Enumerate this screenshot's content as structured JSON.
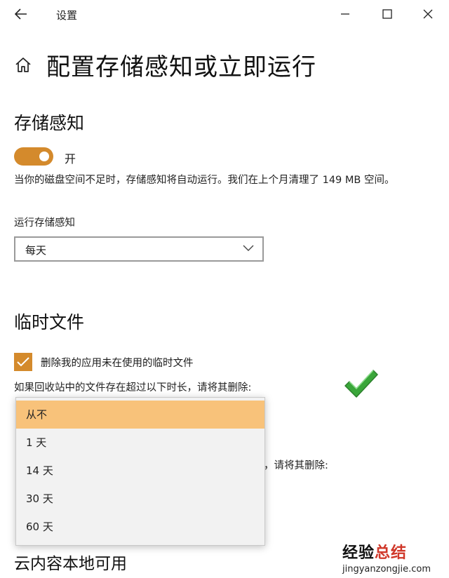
{
  "window": {
    "title": "设置",
    "back_icon": "back-arrow-icon",
    "minimize_icon": "minimize-icon",
    "maximize_icon": "maximize-icon",
    "close_icon": "close-icon"
  },
  "page": {
    "home_icon": "home-icon",
    "title": "配置存储感知或立即运行"
  },
  "storage_sense": {
    "heading": "存储感知",
    "toggle_state": "开",
    "toggle_on": true,
    "description": "当你的磁盘空间不足时，存储感知将自动运行。我们在上个月清理了 149 MB 空间。",
    "run_label": "运行存储感知",
    "run_value": "每天"
  },
  "temp_files": {
    "heading": "临时文件",
    "delete_checkbox_label": "删除我的应用未在使用的临时文件",
    "delete_checked": true,
    "recycle_label": "如果回收站中的文件存在超过以下时长，请将其删除:",
    "hidden_label_fragment": "，请将其删除:",
    "options": [
      "从不",
      "1 天",
      "14 天",
      "30 天",
      "60 天"
    ],
    "selected_index": 0
  },
  "cloud": {
    "heading": "云内容本地可用"
  },
  "watermark": {
    "main": "经验总结",
    "main_black": "经验",
    "main_red": "总结",
    "sub": "jingyanzongjie.com"
  },
  "colors": {
    "accent": "#d48a2c",
    "selected_option": "#f8c27a",
    "green_check": "#3aa63a",
    "watermark_red": "#d0382a"
  }
}
